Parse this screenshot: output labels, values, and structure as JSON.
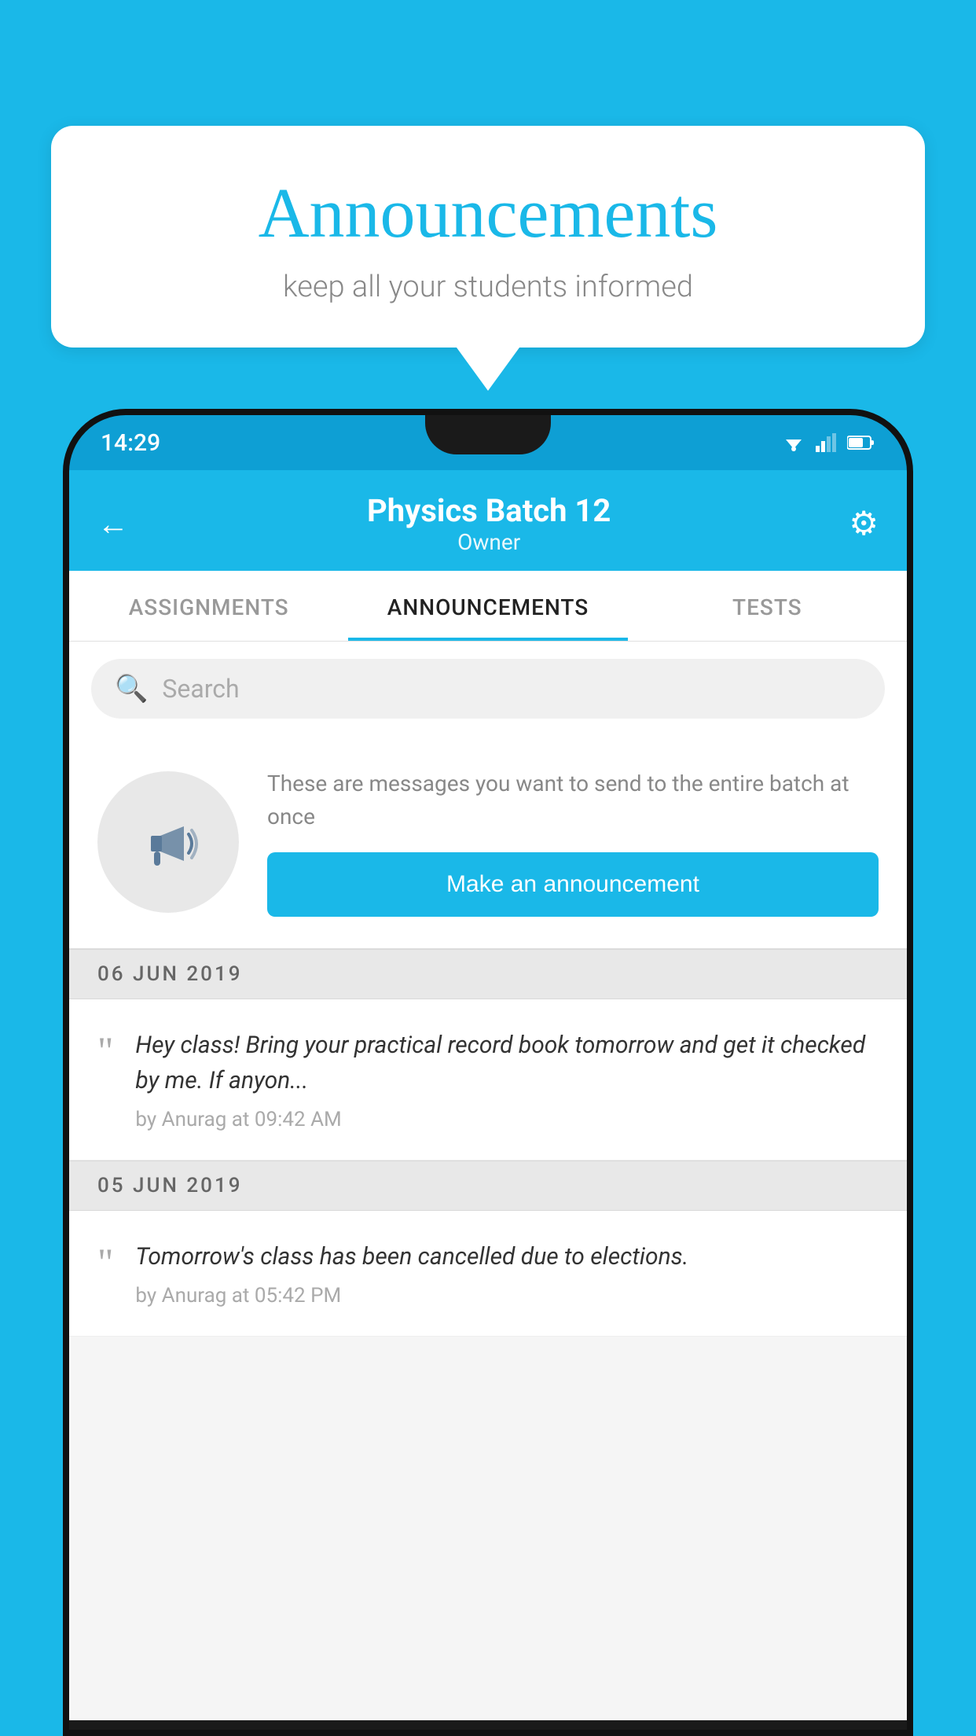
{
  "background": {
    "color": "#1ab8e8"
  },
  "speech_bubble": {
    "title": "Announcements",
    "subtitle": "keep all your students informed"
  },
  "phone": {
    "status_bar": {
      "time": "14:29"
    },
    "header": {
      "title": "Physics Batch 12",
      "subtitle": "Owner",
      "back_label": "←",
      "gear_label": "⚙"
    },
    "tabs": [
      {
        "label": "ASSIGNMENTS",
        "active": false
      },
      {
        "label": "ANNOUNCEMENTS",
        "active": true
      },
      {
        "label": "TESTS",
        "active": false
      }
    ],
    "search": {
      "placeholder": "Search"
    },
    "promo": {
      "description": "These are messages you want to send to the entire batch at once",
      "button_label": "Make an announcement"
    },
    "announcements": [
      {
        "date": "06  JUN  2019",
        "text": "Hey class! Bring your practical record book tomorrow and get it checked by me. If anyon...",
        "meta": "by Anurag at 09:42 AM"
      },
      {
        "date": "05  JUN  2019",
        "text": "Tomorrow's class has been cancelled due to elections.",
        "meta": "by Anurag at 05:42 PM"
      }
    ]
  }
}
